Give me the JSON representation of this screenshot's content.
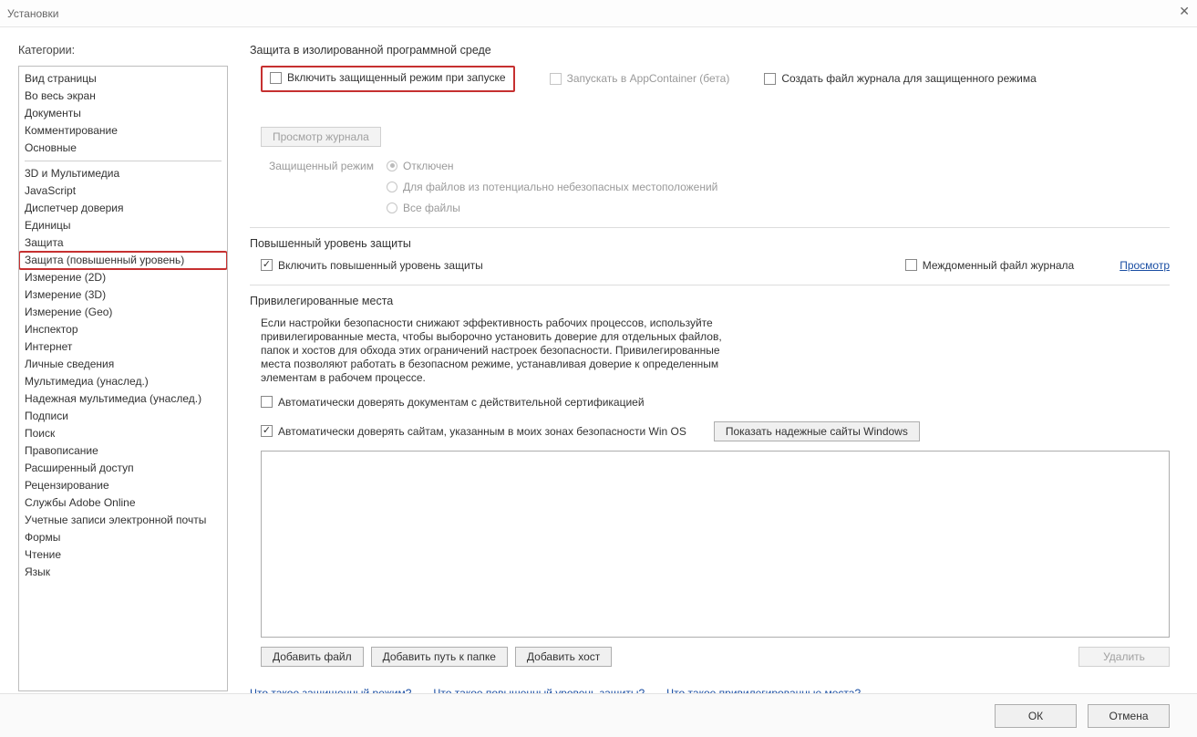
{
  "window": {
    "title": "Установки"
  },
  "sidebar": {
    "title": "Категории:",
    "group1": [
      "Вид страницы",
      "Во весь экран",
      "Документы",
      "Комментирование",
      "Основные"
    ],
    "group2": [
      "3D и Мультимедиа",
      "JavaScript",
      "Диспетчер доверия",
      "Единицы",
      "Защита",
      "Защита (повышенный уровень)",
      "Измерение (2D)",
      "Измерение (3D)",
      "Измерение (Geo)",
      "Инспектор",
      "Интернет",
      "Личные сведения",
      "Мультимедиа (унаслед.)",
      "Надежная мультимедиа (унаслед.)",
      "Подписи",
      "Поиск",
      "Правописание",
      "Расширенный доступ",
      "Рецензирование",
      "Службы Adobe Online",
      "Учетные записи электронной почты",
      "Формы",
      "Чтение",
      "Язык"
    ],
    "selectedIndex": 5
  },
  "section1": {
    "title": "Защита в изолированной программной среде",
    "enableProtected": "Включить защищенный режим при запуске",
    "appContainer": "Запускать в AppContainer (бета)",
    "createLog": "Создать файл журнала для защищенного режима",
    "viewLogBtn": "Просмотр журнала",
    "protectedModeLabel": "Защищенный режим",
    "radios": {
      "off": "Отключен",
      "unsafe": "Для файлов из потенциально небезопасных местоположений",
      "all": "Все файлы"
    }
  },
  "section2": {
    "title": "Повышенный уровень защиты",
    "enableEnhanced": "Включить повышенный уровень защиты",
    "crossDomainLog": "Междоменный файл журнала",
    "viewLink": "Просмотр"
  },
  "section3": {
    "title": "Привилегированные места",
    "description": "Если настройки безопасности снижают эффективность рабочих процессов, используйте привилегированные места, чтобы выборочно установить доверие для отдельных файлов, папок и хостов для обхода этих ограничений настроек безопасности. Привилегированные места позволяют работать в безопасном режиме, устанавливая доверие к определенным элементам в рабочем процессе.",
    "autoTrustCert": "Автоматически доверять документам с действительной сертификацией",
    "autoTrustWinOS": "Автоматически доверять сайтам, указанным в моих зонах безопасности Win OS",
    "showTrustedBtn": "Показать надежные сайты Windows",
    "addFile": "Добавить файл",
    "addFolder": "Добавить путь к папке",
    "addHost": "Добавить хост",
    "deleteBtn": "Удалить"
  },
  "links": {
    "whatProtected": "Что такое защищенный режим?",
    "whatEnhanced": "Что такое повышенный уровень защиты?",
    "whatPrivileged": "Что такое привилегированные места?"
  },
  "footer": {
    "ok": "ОК",
    "cancel": "Отмена"
  }
}
